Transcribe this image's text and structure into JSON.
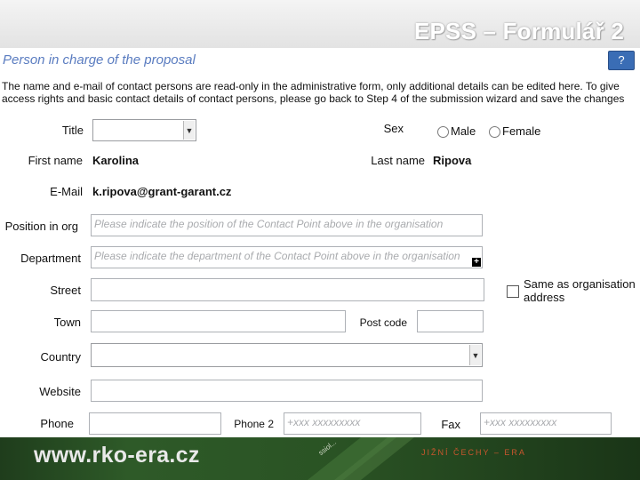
{
  "slide": {
    "title": "EPSS – Formulář 2"
  },
  "form": {
    "section_title": "Person in charge of the proposal",
    "help_label": "?",
    "note": "The name and e-mail of contact persons are read-only in the administrative form, only additional details can be edited here. To give access rights and basic contact details of contact persons, please go back to Step 4 of the submission wizard and save the changes",
    "title_label": "Title",
    "title_value": "",
    "sex_label": "Sex",
    "sex_options": [
      "Male",
      "Female"
    ],
    "first_name_label": "First name",
    "first_name_value": "Karolina",
    "last_name_label": "Last  name",
    "last_name_value": "Ripova",
    "email_label": "E-Mail",
    "email_value": "k.ripova@grant-garant.cz",
    "position_label": "Position in org",
    "position_placeholder": "Please indicate the position of the Contact Point above in the organisation",
    "department_label": "Department",
    "department_placeholder": "Please indicate the department of the Contact Point above in the organisation",
    "street_label": "Street",
    "same_as_org_label": "Same as organisation address",
    "town_label": "Town",
    "postcode_label": "Post code",
    "country_label": "Country",
    "website_label": "Website",
    "phone_label": "Phone",
    "phone2_label": "Phone 2",
    "phone2_placeholder": "+xxx xxxxxxxxx",
    "fax_label": "Fax",
    "fax_placeholder": "+xxx xxxxxxxxx"
  },
  "footer": {
    "url": "www.rko-era.cz",
    "region": "JIŽNÍ ČECHY – ERA",
    "deco_text": "ssiol..."
  },
  "colors": {
    "footer_green": "#2e5a28",
    "link_blue": "#5a7cc0",
    "help_blue": "#3a6db5"
  }
}
